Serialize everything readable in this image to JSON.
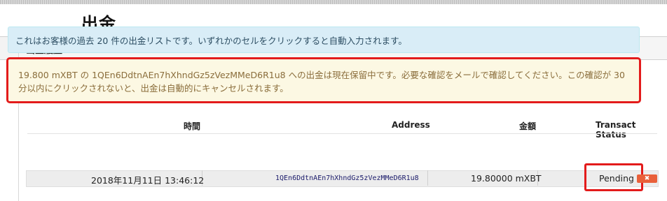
{
  "page": {
    "title": "出金"
  },
  "panel": {
    "heading": "出金履歴",
    "info": "これはお客様の過去 20 件の出金リストです。いずれかのセルをクリックすると自動入力されます。",
    "warning": "19.800 mXBT の 1QEn6DdtnAEn7hXhndGz5zVezMMeD6R1u8 への出金は現在保留中です。必要な確認をメールで確認してください。この確認が 30 分以内にクリックされないと、出金は自動的にキャンセルされます。"
  },
  "table": {
    "columns": {
      "time": "時間",
      "address": "Address",
      "amount": "金額",
      "status": "Transact Status"
    },
    "rows": [
      {
        "time": "2018年11月11日 13:46:12",
        "address": "1QEn6DdtnAEn7hXhndGz5zVezMMeD6R1u8",
        "amount": "19.80000 mXBT",
        "status": "Pending"
      }
    ],
    "cancel_icon": "close-icon"
  },
  "colors": {
    "highlight": "#e31b1b",
    "info_bg": "#d9edf7",
    "warning_bg": "#fcf8e3",
    "warning_text": "#8a6d3b",
    "cancel_bg": "#e9603a"
  }
}
